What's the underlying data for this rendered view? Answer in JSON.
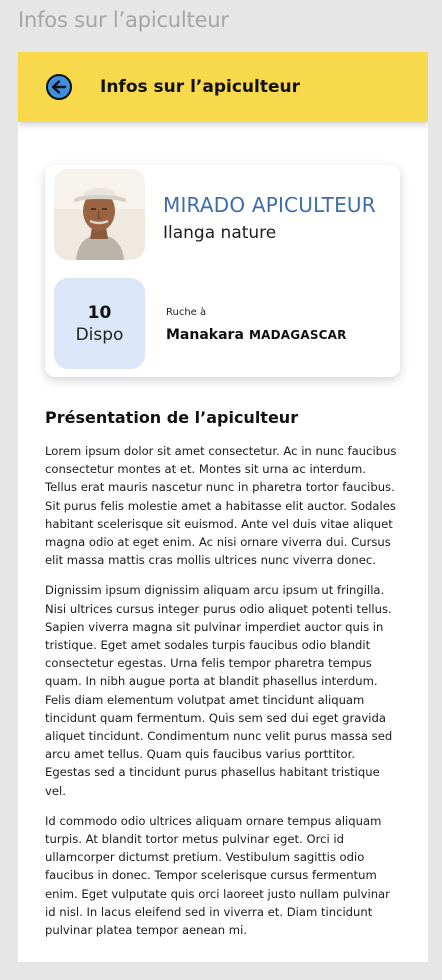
{
  "screen_title": "Infos sur l’apiculteur",
  "app_bar": {
    "back_icon": "arrow-left-circle-icon",
    "title": "Infos sur l’apiculteur",
    "accent_color": "#f8d94b"
  },
  "beekeeper": {
    "name": "MIRADO APICULTEUR",
    "company": "Ilanga nature",
    "availability_count": "10",
    "availability_label": "Dispo",
    "hive_label": "Ruche à",
    "hive_city": "Manakara",
    "hive_country": "MADAGASCAR",
    "name_color": "#3e6ea8"
  },
  "presentation": {
    "title": "Présentation de l’apiculteur",
    "paragraphs": [
      "Lorem ipsum dolor sit amet consectetur. Ac in nunc faucibus consectetur montes at et. Montes sit urna ac interdum. Tellus erat mauris nascetur nunc in pharetra tortor faucibus. Sit purus felis molestie amet a habitasse elit auctor. Sodales habitant scelerisque sit euismod. Ante vel duis vitae aliquet magna odio at eget enim. Ac nisi ornare viverra dui. Cursus elit massa mattis cras mollis ultrices nunc viverra donec.",
      "Dignissim ipsum dignissim aliquam arcu ipsum ut fringilla. Nisi ultrices cursus integer purus odio aliquet potenti tellus. Sapien viverra magna sit pulvinar imperdiet auctor quis in tristique. Eget amet sodales turpis faucibus odio blandit consectetur egestas. Urna felis tempor pharetra tempus quam. In nibh augue porta at blandit phasellus interdum. Felis diam elementum volutpat amet tincidunt aliquam tincidunt quam fermentum. Quis sem sed dui eget gravida aliquet tincidunt. Condimentum nunc velit purus massa sed arcu amet tellus. Quam quis faucibus varius porttitor. Egestas sed a tincidunt purus phasellus habitant tristique vel.",
      "Id commodo odio ultrices aliquam ornare tempus aliquam turpis. At blandit tortor metus pulvinar eget. Orci id ullamcorper dictumst pretium. Vestibulum sagittis odio faucibus in donec. Tempor scelerisque cursus fermentum enim. Eget vulputate quis orci laoreet justo nullam pulvinar id nisl. In lacus eleifend sed in viverra et. Diam tincidunt pulvinar platea tempor aenean mi."
    ]
  }
}
